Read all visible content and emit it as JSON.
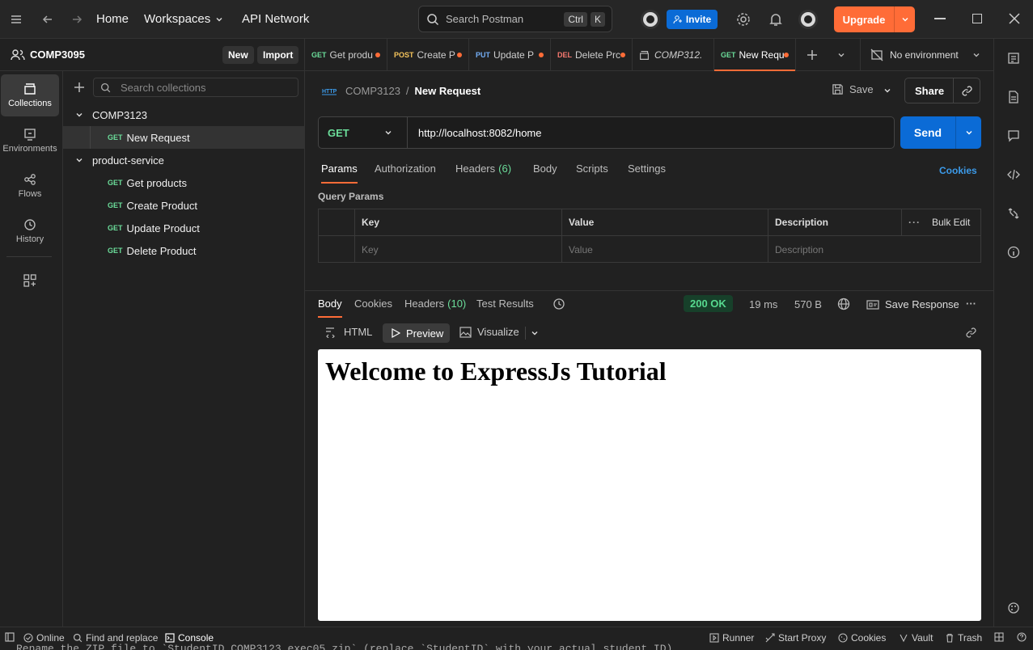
{
  "topbar": {
    "home": "Home",
    "workspaces": "Workspaces",
    "api_network": "API Network",
    "search_placeholder": "Search Postman",
    "kbd_ctrl": "Ctrl",
    "kbd_k": "K",
    "invite": "Invite",
    "upgrade": "Upgrade"
  },
  "workspace": {
    "name": "COMP3095",
    "new": "New",
    "import": "Import"
  },
  "rail": [
    {
      "label": "Collections",
      "icon": "collections-icon"
    },
    {
      "label": "Environments",
      "icon": "environments-icon"
    },
    {
      "label": "Flows",
      "icon": "flows-icon"
    },
    {
      "label": "History",
      "icon": "history-icon"
    }
  ],
  "sidebar": {
    "search_placeholder": "Search collections",
    "collections": [
      {
        "name": "COMP3123",
        "requests": [
          {
            "method": "GET",
            "name": "New Request"
          }
        ]
      },
      {
        "name": "product-service",
        "requests": [
          {
            "method": "GET",
            "name": "Get products"
          },
          {
            "method": "GET",
            "name": "Create Product"
          },
          {
            "method": "GET",
            "name": "Update Product"
          },
          {
            "method": "GET",
            "name": "Delete Product"
          }
        ]
      }
    ]
  },
  "tabs": [
    {
      "method": "GET",
      "name": "Get produ",
      "color": "#6bdd9a"
    },
    {
      "method": "POST",
      "name": "Create P",
      "color": "#f5c45c"
    },
    {
      "method": "PUT",
      "name": "Update P",
      "color": "#74aef6"
    },
    {
      "method": "DEL",
      "name": "Delete Prc",
      "color": "#f5786f"
    },
    {
      "method": "",
      "name": "COMP312.",
      "color": "#cfcfcf"
    },
    {
      "method": "GET",
      "name": "New Requ",
      "color": "#6bdd9a"
    }
  ],
  "environment": "No environment",
  "breadcrumb": {
    "collection": "COMP3123",
    "separator": "/",
    "request": "New Request"
  },
  "actions": {
    "save": "Save",
    "share": "Share"
  },
  "request": {
    "method": "GET",
    "url": "http://localhost:8082/home",
    "send": "Send",
    "tabs": [
      "Params",
      "Authorization",
      "Headers",
      "Body",
      "Scripts",
      "Settings"
    ],
    "headers_count": "(6)",
    "cookies": "Cookies",
    "query_params_title": "Query Params",
    "columns": {
      "key": "Key",
      "value": "Value",
      "description": "Description",
      "bulk_edit": "Bulk Edit"
    },
    "placeholders": {
      "key": "Key",
      "value": "Value",
      "description": "Description"
    }
  },
  "response": {
    "tabs": [
      "Body",
      "Cookies",
      "Headers",
      "Test Results"
    ],
    "headers_count": "(10)",
    "status": "200 OK",
    "time": "19 ms",
    "size": "570 B",
    "save_response": "Save Response",
    "views": {
      "html": "HTML",
      "preview": "Preview",
      "visualize": "Visualize"
    },
    "preview_heading": "Welcome to ExpressJs Tutorial"
  },
  "statusbar": {
    "online": "Online",
    "find_replace": "Find and replace",
    "console": "Console",
    "runner": "Runner",
    "start_proxy": "Start Proxy",
    "cookies": "Cookies",
    "vault": "Vault",
    "trash": "Trash"
  },
  "background_text": "Rename the ZIP file to `StudentID_COMP3123_exec05.zip` (replace `StudentID` with your actual student ID)",
  "colors": {
    "accent": "#ff6c37",
    "primary": "#0b6bd6",
    "get": "#6bdd9a",
    "status_ok": "#14a15a"
  }
}
